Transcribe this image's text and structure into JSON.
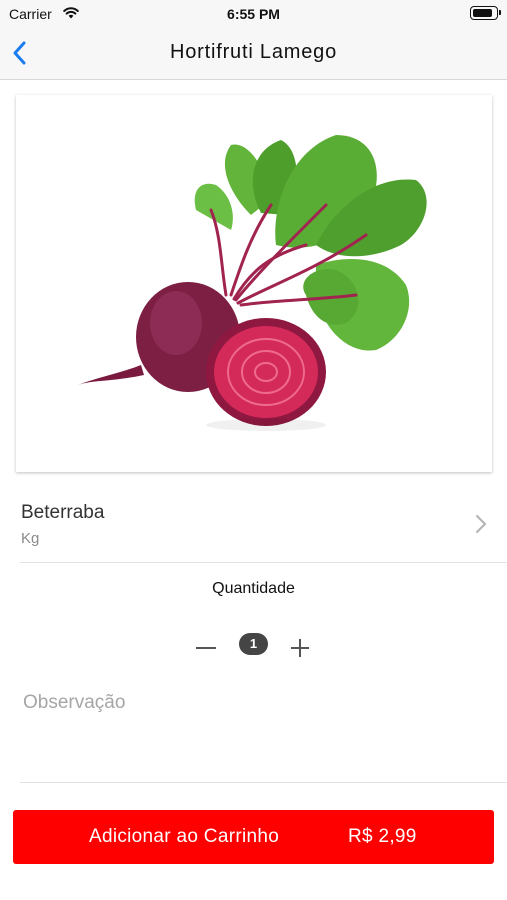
{
  "status_bar": {
    "carrier": "Carrier",
    "time": "6:55 PM",
    "battery_level": 0.9
  },
  "nav": {
    "title": "Hortifruti Lamego",
    "back_icon": "chevron-left-icon"
  },
  "product": {
    "image_icon": "beetroot-image",
    "name": "Beterraba",
    "unit": "Kg"
  },
  "quantity": {
    "label": "Quantidade",
    "value": "1"
  },
  "observation": {
    "placeholder": "Observação",
    "value": ""
  },
  "cart_button": {
    "label": "Adicionar ao Carrinho",
    "price": "R$ 2,99"
  },
  "colors": {
    "accent_blue": "#1a7cf0",
    "cart_red": "#fe0000",
    "badge_gray": "#454545"
  }
}
